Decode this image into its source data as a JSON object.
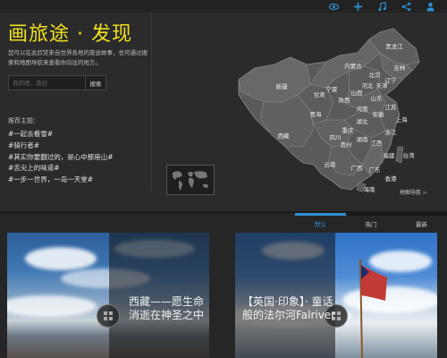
{
  "header": {
    "icons": [
      {
        "name": "eye-icon",
        "glyph": "👁"
      },
      {
        "name": "plus-icon",
        "glyph": "+"
      },
      {
        "name": "music-icon",
        "glyph": "♫"
      },
      {
        "name": "share-icon",
        "glyph": "share"
      },
      {
        "name": "user-icon",
        "glyph": "user"
      }
    ],
    "accent": "#2f8fd1"
  },
  "hero": {
    "title": "画旅途 · 发现",
    "title_color": "#f0e020",
    "description": "您可以在此欣赏来自世界各地的旅途故事，也可通过搜索和地图导航来查看你向往的地方。",
    "search": {
      "placeholder": "目的地、游记",
      "button": "搜索"
    },
    "topics_heading": "推荐主题：",
    "topics": [
      "#一起去看雪#",
      "#骑行者#",
      "#其实你要翻过的，是心中那座山#",
      "#舌尖上的味道#",
      "#一步一世界，一岛一天堂#"
    ]
  },
  "map": {
    "provinces": [
      "新疆",
      "西藏",
      "青海",
      "甘肃",
      "内蒙古",
      "黑龙江",
      "吉林",
      "辽宁",
      "北京",
      "天津",
      "河北",
      "山西",
      "陕西",
      "宁夏",
      "山东",
      "河南",
      "四川",
      "重庆",
      "湖北",
      "安徽",
      "江苏",
      "上海",
      "浙江",
      "贵州",
      "湖南",
      "江西",
      "福建",
      "云南",
      "广西",
      "广东",
      "台湾",
      "香港",
      "海南"
    ],
    "nav_label": "地图导航 ››"
  },
  "tabs": [
    {
      "label": "默认",
      "active": true
    },
    {
      "label": "热门",
      "active": false
    },
    {
      "label": "最新",
      "active": false
    }
  ],
  "cards": [
    {
      "title": "西藏——愿生命消逝在神圣之中"
    },
    {
      "title": "【英国·印象】· 童话般的法尔河Falriver"
    }
  ]
}
